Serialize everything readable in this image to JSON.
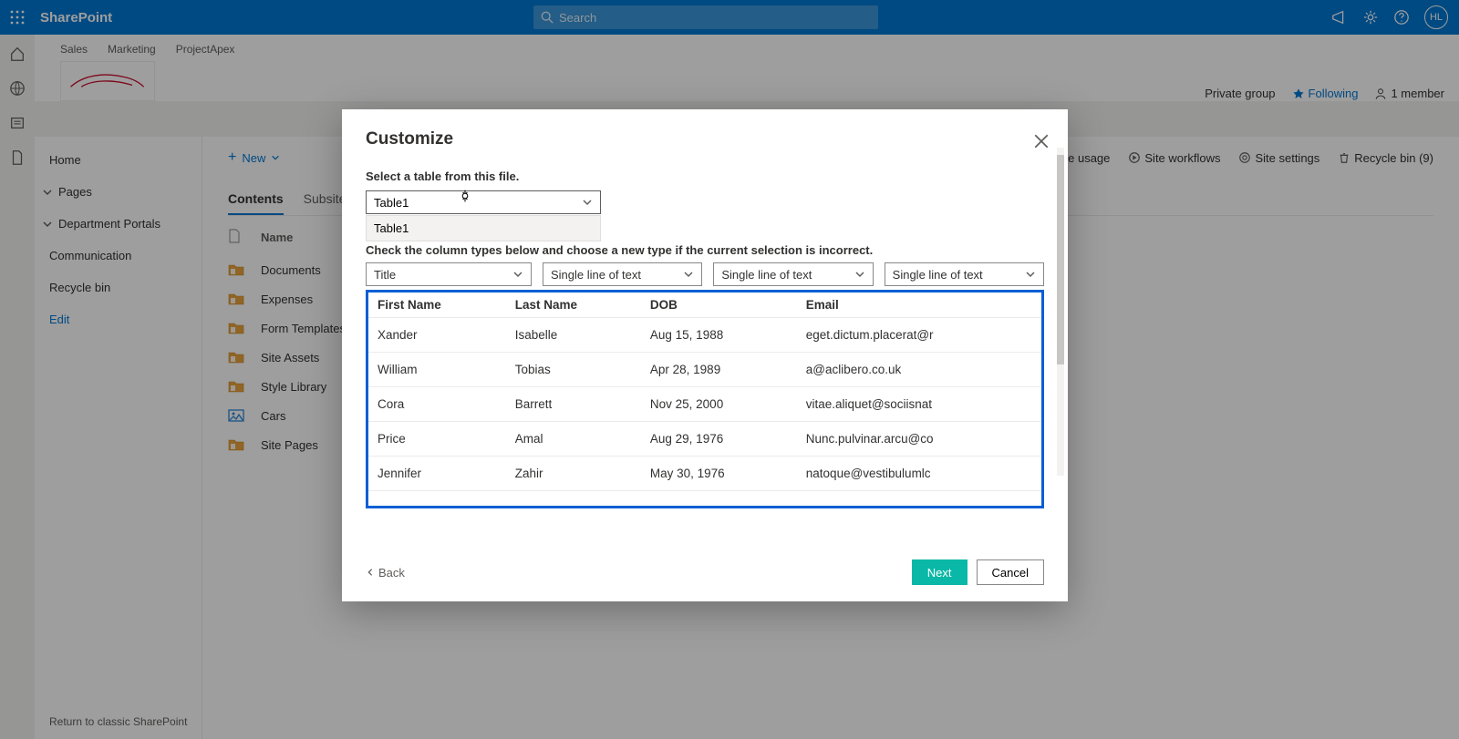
{
  "suite": {
    "brand": "SharePoint",
    "search_placeholder": "Search",
    "avatar_initials": "HL"
  },
  "topnav": {
    "items": [
      "Sales",
      "Marketing",
      "ProjectApex"
    ]
  },
  "site_actions": {
    "private": "Private group",
    "following": "Following",
    "members": "1 member"
  },
  "leftnav": {
    "items": [
      "Home",
      "Pages",
      "Department Portals",
      "Communication",
      "Recycle bin"
    ],
    "edit": "Edit",
    "return": "Return to classic SharePoint"
  },
  "cmdbar": {
    "new": "New",
    "right": {
      "usage": "Site usage",
      "workflows": "Site workflows",
      "settings": "Site settings",
      "recycle": "Recycle bin (9)"
    }
  },
  "tabs": {
    "contents": "Contents",
    "subsites": "Subsites"
  },
  "list": {
    "header_name": "Name",
    "rows": [
      "Documents",
      "Expenses",
      "Form Templates",
      "Site Assets",
      "Style Library",
      "Cars",
      "Site Pages"
    ]
  },
  "dialog": {
    "title": "Customize",
    "select_label": "Select a table from this file.",
    "table_selected": "Table1",
    "table_option": "Table1",
    "check_label": "Check the column types below and choose a new type if the current selection is incorrect.",
    "coltypes": [
      "Title",
      "Single line of text",
      "Single line of text",
      "Single line of text"
    ],
    "preview_headers": [
      "First Name",
      "Last Name",
      "DOB",
      "Email"
    ],
    "preview_rows": [
      [
        "Xander",
        "Isabelle",
        "Aug 15, 1988",
        "eget.dictum.placerat@r"
      ],
      [
        "William",
        "Tobias",
        "Apr 28, 1989",
        "a@aclibero.co.uk"
      ],
      [
        "Cora",
        "Barrett",
        "Nov 25, 2000",
        "vitae.aliquet@sociisnat"
      ],
      [
        "Price",
        "Amal",
        "Aug 29, 1976",
        "Nunc.pulvinar.arcu@co"
      ],
      [
        "Jennifer",
        "Zahir",
        "May 30, 1976",
        "natoque@vestibulumlc"
      ]
    ],
    "back": "Back",
    "next": "Next",
    "cancel": "Cancel"
  }
}
